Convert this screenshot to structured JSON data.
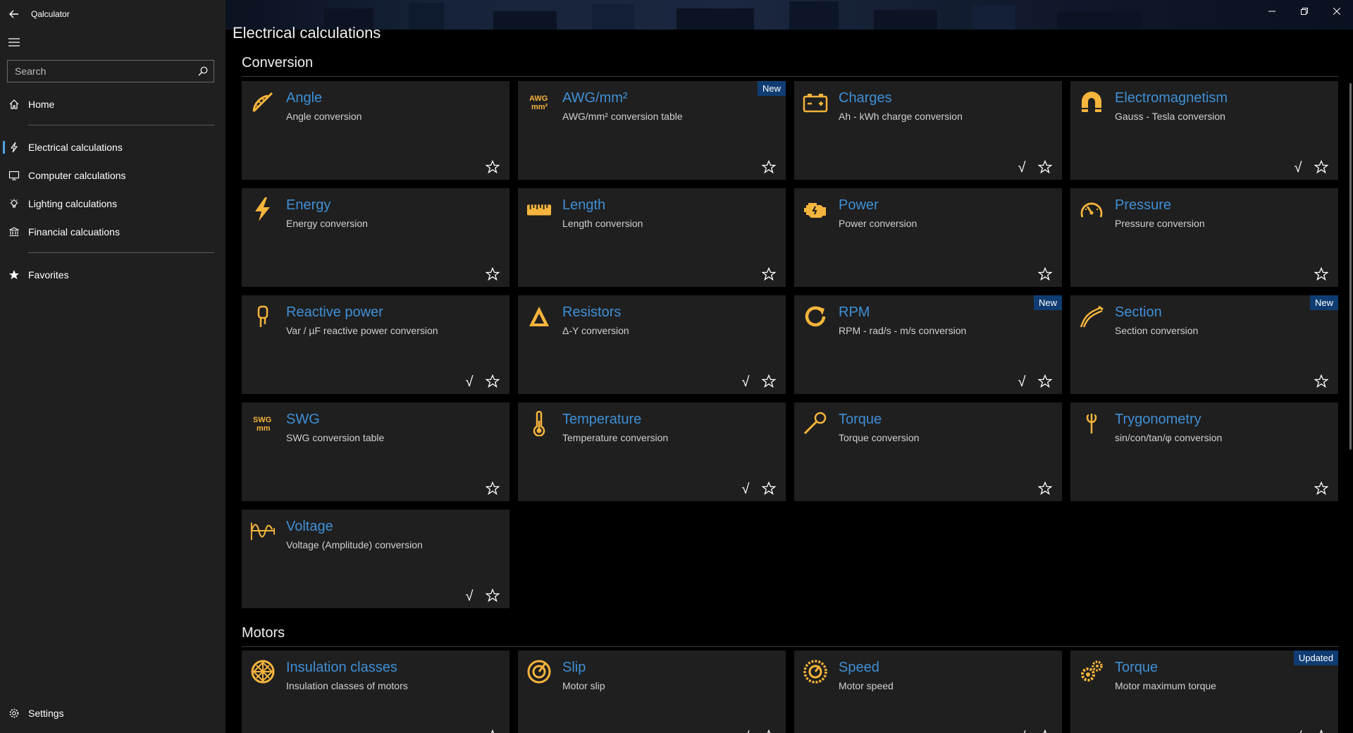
{
  "app": {
    "title": "Qalculator"
  },
  "search": {
    "placeholder": "Search"
  },
  "nav": {
    "home": "Home",
    "items": [
      {
        "label": "Electrical calculations",
        "icon": "lightning-icon"
      },
      {
        "label": "Computer calculations",
        "icon": "monitor-icon"
      },
      {
        "label": "Lighting calculations",
        "icon": "lightbulb-icon"
      },
      {
        "label": "Financial calcuations",
        "icon": "bank-icon"
      }
    ],
    "favorites": "Favorites",
    "settings": "Settings"
  },
  "page": {
    "title": "Electrical calculations"
  },
  "sections": {
    "conversion": "Conversion",
    "motors": "Motors"
  },
  "colors": {
    "accent": "#3f8fd6",
    "icon": "#f5b43c",
    "card_bg": "#1f1f1f",
    "badge": "#0f3d73"
  },
  "conversion_cards": [
    {
      "title": "Angle",
      "subtitle": "Angle conversion",
      "icon": "protractor-icon",
      "badge": "",
      "checked": false
    },
    {
      "title": "AWG/mm²",
      "subtitle": "AWG/mm² conversion table",
      "icon": "awg-mm-icon",
      "badge": "New",
      "checked": false
    },
    {
      "title": "Charges",
      "subtitle": "Ah - kWh charge conversion",
      "icon": "battery-icon",
      "badge": "",
      "checked": true
    },
    {
      "title": "Electromagnetism",
      "subtitle": "Gauss - Tesla conversion",
      "icon": "magnet-icon",
      "badge": "",
      "checked": true
    },
    {
      "title": "Energy",
      "subtitle": "Energy conversion",
      "icon": "lightning-icon",
      "badge": "",
      "checked": false
    },
    {
      "title": "Length",
      "subtitle": "Length conversion",
      "icon": "ruler-icon",
      "badge": "",
      "checked": false
    },
    {
      "title": "Power",
      "subtitle": "Power conversion",
      "icon": "engine-icon",
      "badge": "",
      "checked": false
    },
    {
      "title": "Pressure",
      "subtitle": "Pressure conversion",
      "icon": "gauge-icon",
      "badge": "",
      "checked": false
    },
    {
      "title": "Reactive power",
      "subtitle": "Var / µF reactive power conversion",
      "icon": "capacitor-icon",
      "badge": "",
      "checked": true
    },
    {
      "title": "Resistors",
      "subtitle": "Δ-Y conversion",
      "icon": "delta-icon",
      "badge": "",
      "checked": true
    },
    {
      "title": "RPM",
      "subtitle": "RPM - rad/s - m/s conversion",
      "icon": "rotate-icon",
      "badge": "New",
      "checked": true
    },
    {
      "title": "Section",
      "subtitle": "Section conversion",
      "icon": "cable-icon",
      "badge": "New",
      "checked": false
    },
    {
      "title": "SWG",
      "subtitle": "SWG conversion table",
      "icon": "swg-mm-icon",
      "badge": "",
      "checked": false
    },
    {
      "title": "Temperature",
      "subtitle": "Temperature conversion",
      "icon": "thermometer-icon",
      "badge": "",
      "checked": true
    },
    {
      "title": "Torque",
      "subtitle": "Torque conversion",
      "icon": "wrench-icon",
      "badge": "",
      "checked": false
    },
    {
      "title": "Trygonometry",
      "subtitle": "sin/con/tan/φ conversion",
      "icon": "phi-icon",
      "badge": "",
      "checked": false
    },
    {
      "title": "Voltage",
      "subtitle": "Voltage (Amplitude) conversion",
      "icon": "waveform-icon",
      "badge": "",
      "checked": true
    }
  ],
  "motor_cards": [
    {
      "title": "Insulation classes",
      "subtitle": "Insulation classes of motors",
      "icon": "insulation-icon",
      "badge": "",
      "checked": false
    },
    {
      "title": "Slip",
      "subtitle": "Motor slip",
      "icon": "target-icon",
      "badge": "",
      "checked": true
    },
    {
      "title": "Speed",
      "subtitle": "Motor speed",
      "icon": "speedometer-icon",
      "badge": "",
      "checked": true
    },
    {
      "title": "Torque",
      "subtitle": "Motor maximum torque",
      "icon": "gears-icon",
      "badge": "Updated",
      "checked": true
    }
  ]
}
